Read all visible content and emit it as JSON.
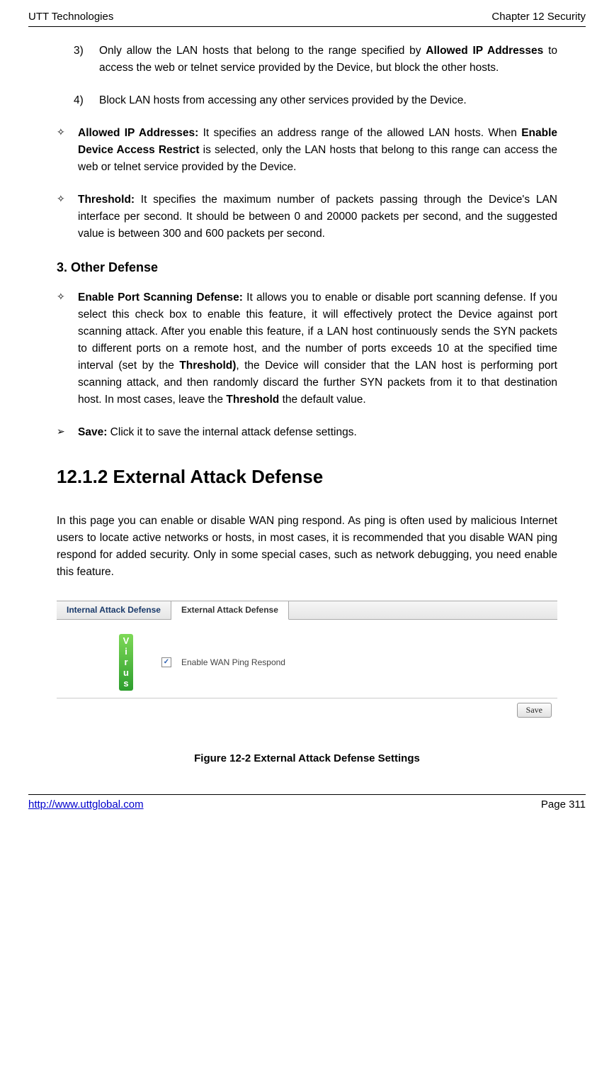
{
  "header": {
    "left": "UTT Technologies",
    "right": "Chapter 12 Security"
  },
  "footer": {
    "link": "http://www.uttglobal.com",
    "page": "Page 311"
  },
  "items": {
    "n3_num": "3)",
    "n3_txt_pre": "Only allow the LAN hosts that belong to the range specified by ",
    "n3_txt_bold": "Allowed IP Addresses",
    "n3_txt_post": " to access the web or telnet service provided by the Device, but block the other hosts.",
    "n4_num": "4)",
    "n4_txt": "Block LAN hosts from accessing any other services provided by the Device.",
    "allowed_bold": "Allowed IP Addresses:",
    "allowed_txt_pre": " It specifies an address range of the allowed LAN hosts. When ",
    "allowed_txt_mid_bold": "Enable Device Access Restrict",
    "allowed_txt_post": " is selected, only the LAN hosts that belong to this range can access the web or telnet service provided by the Device.",
    "threshold_bold": "Threshold:",
    "threshold_txt": " It specifies the maximum number of packets passing through the Device's LAN interface per second. It should be between 0 and 20000 packets per second, and the suggested value is between 300 and 600 packets per second."
  },
  "section3": {
    "heading": "3.   Other Defense",
    "port_bold": "Enable Port Scanning Defense:",
    "port_txt_pre": " It allows you to enable or disable port scanning defense. If you select this check box to enable this feature, it will effectively protect the Device against port scanning attack. After you enable this feature, if a LAN host continuously sends the SYN packets to different ports on a remote host, and the number of ports exceeds 10 at the specified time interval (set by the ",
    "port_txt_mid_bold": "Threshold)",
    "port_txt_post1": ", the Device will consider that the LAN host is performing port scanning attack, and then randomly discard the further SYN packets from it to that destination host. In most cases, leave the ",
    "port_txt_post_bold": "Threshold",
    "port_txt_post2": " the default value.",
    "save_bold": "Save:",
    "save_txt": " Click it to save the internal attack defense settings."
  },
  "section1212": {
    "heading": "12.1.2  External Attack Defense",
    "intro": "In this page you can enable or disable WAN ping respond. As ping is often used by malicious Internet users to locate active networks or hosts, in most cases, it is recommended that you disable WAN ping respond for added security. Only in some special cases, such as network debugging, you need enable this feature."
  },
  "panel": {
    "tab_inactive": "Internal Attack Defense",
    "tab_active": "External Attack Defense",
    "virus_v": "V",
    "virus_i": "i",
    "virus_r": "r",
    "virus_u": "u",
    "virus_s": "s",
    "checkbox_check": "✓",
    "checkbox_label": "Enable WAN Ping Respond",
    "save_btn": "Save"
  },
  "figure_caption": "Figure 12-2 External Attack Defense Settings",
  "glyphs": {
    "diamond": "✧",
    "arrow": "➢"
  }
}
